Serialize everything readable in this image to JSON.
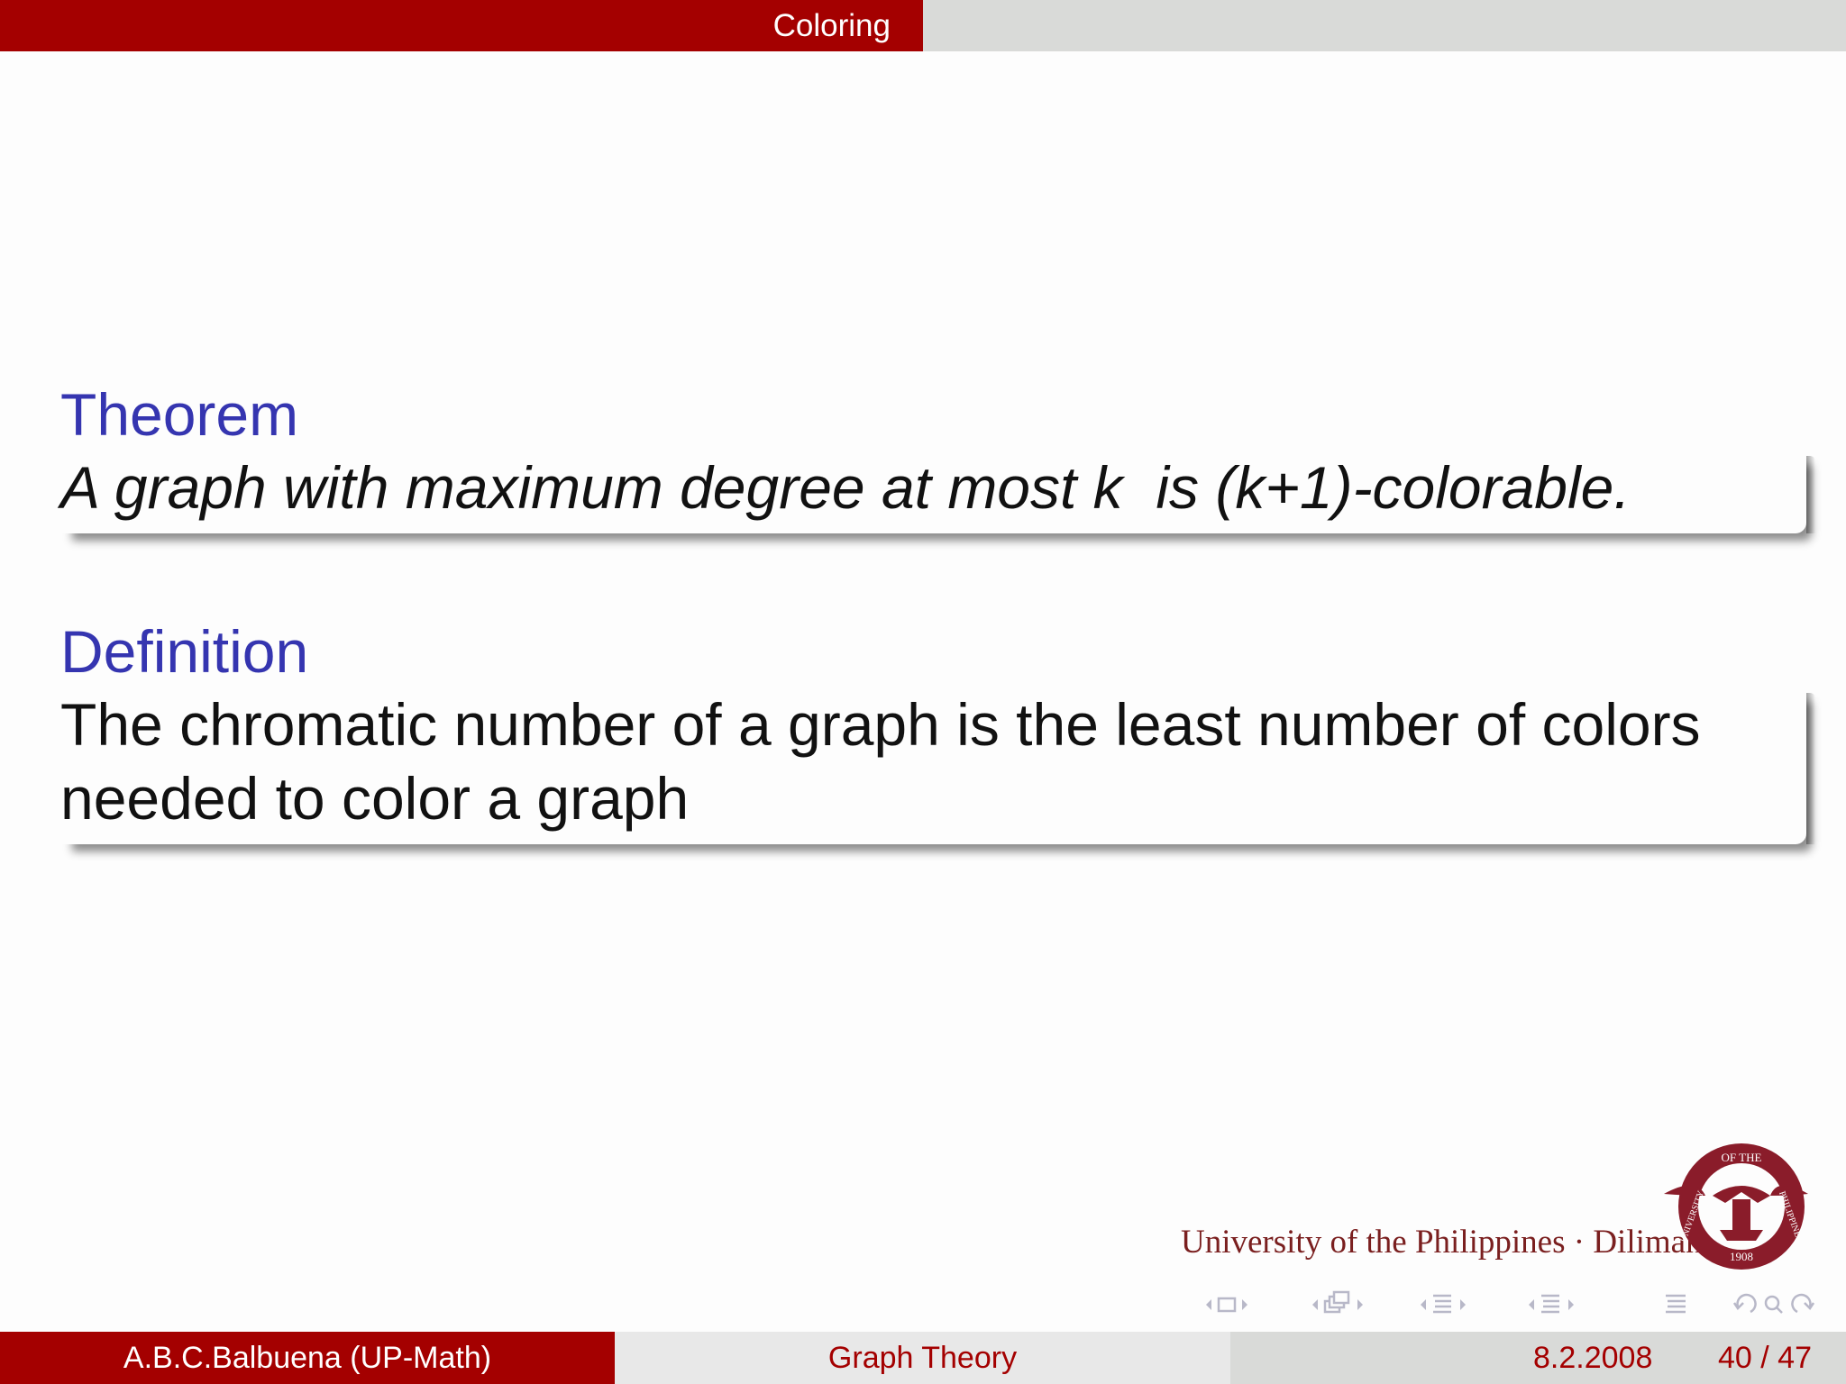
{
  "header": {
    "section_title": "Coloring"
  },
  "theorem": {
    "title": "Theorem",
    "text": "A graph with maximum degree at most k  is (k+1)-colorable."
  },
  "definition": {
    "title": "Definition",
    "line1": "The chromatic number of a graph is the least number of colors",
    "line2": "needed to color a graph"
  },
  "logo": {
    "text": "University of the Philippines · Diliman",
    "seal_top": "OF THE",
    "seal_left": "UNIVERSITY",
    "seal_right": "PHILIPPINES",
    "seal_year": "1908"
  },
  "footer": {
    "author": "A.B.C.Balbuena  (UP-Math)",
    "title": "Graph Theory",
    "date": "8.2.2008",
    "page": "40 / 47"
  },
  "colors": {
    "accent": "#a40000",
    "block_title": "#3535b0",
    "header_gray": "#d9dad8",
    "logo": "#7a1f1f"
  }
}
